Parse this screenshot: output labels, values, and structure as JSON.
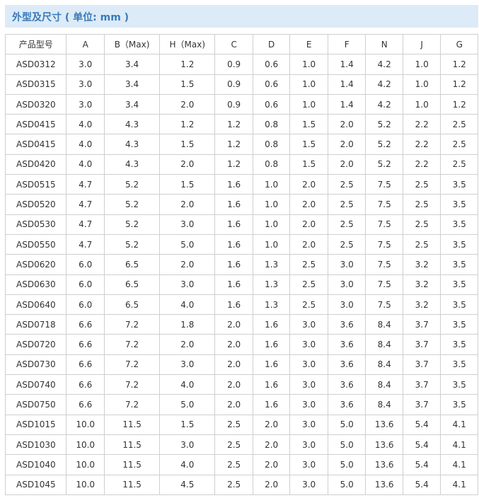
{
  "section": {
    "title": "外型及尺寸 ( 单位: mm )"
  },
  "table": {
    "headers": [
      "产品型号",
      "A",
      "B（Max)",
      "H（Max)",
      "C",
      "D",
      "E",
      "F",
      "N",
      "J",
      "G"
    ],
    "rows": [
      [
        "ASD0312",
        "3.0",
        "3.4",
        "1.2",
        "0.9",
        "0.6",
        "1.0",
        "1.4",
        "4.2",
        "1.0",
        "1.2"
      ],
      [
        "ASD0315",
        "3.0",
        "3.4",
        "1.5",
        "0.9",
        "0.6",
        "1.0",
        "1.4",
        "4.2",
        "1.0",
        "1.2"
      ],
      [
        "ASD0320",
        "3.0",
        "3.4",
        "2.0",
        "0.9",
        "0.6",
        "1.0",
        "1.4",
        "4.2",
        "1.0",
        "1.2"
      ],
      [
        "ASD0415",
        "4.0",
        "4.3",
        "1.2",
        "1.2",
        "0.8",
        "1.5",
        "2.0",
        "5.2",
        "2.2",
        "2.5"
      ],
      [
        "ASD0415",
        "4.0",
        "4.3",
        "1.5",
        "1.2",
        "0.8",
        "1.5",
        "2.0",
        "5.2",
        "2.2",
        "2.5"
      ],
      [
        "ASD0420",
        "4.0",
        "4.3",
        "2.0",
        "1.2",
        "0.8",
        "1.5",
        "2.0",
        "5.2",
        "2.2",
        "2.5"
      ],
      [
        "ASD0515",
        "4.7",
        "5.2",
        "1.5",
        "1.6",
        "1.0",
        "2.0",
        "2.5",
        "7.5",
        "2.5",
        "3.5"
      ],
      [
        "ASD0520",
        "4.7",
        "5.2",
        "2.0",
        "1.6",
        "1.0",
        "2.0",
        "2.5",
        "7.5",
        "2.5",
        "3.5"
      ],
      [
        "ASD0530",
        "4.7",
        "5.2",
        "3.0",
        "1.6",
        "1.0",
        "2.0",
        "2.5",
        "7.5",
        "2.5",
        "3.5"
      ],
      [
        "ASD0550",
        "4.7",
        "5.2",
        "5.0",
        "1.6",
        "1.0",
        "2.0",
        "2.5",
        "7.5",
        "2.5",
        "3.5"
      ],
      [
        "ASD0620",
        "6.0",
        "6.5",
        "2.0",
        "1.6",
        "1.3",
        "2.5",
        "3.0",
        "7.5",
        "3.2",
        "3.5"
      ],
      [
        "ASD0630",
        "6.0",
        "6.5",
        "3.0",
        "1.6",
        "1.3",
        "2.5",
        "3.0",
        "7.5",
        "3.2",
        "3.5"
      ],
      [
        "ASD0640",
        "6.0",
        "6.5",
        "4.0",
        "1.6",
        "1.3",
        "2.5",
        "3.0",
        "7.5",
        "3.2",
        "3.5"
      ],
      [
        "ASD0718",
        "6.6",
        "7.2",
        "1.8",
        "2.0",
        "1.6",
        "3.0",
        "3.6",
        "8.4",
        "3.7",
        "3.5"
      ],
      [
        "ASD0720",
        "6.6",
        "7.2",
        "2.0",
        "2.0",
        "1.6",
        "3.0",
        "3.6",
        "8.4",
        "3.7",
        "3.5"
      ],
      [
        "ASD0730",
        "6.6",
        "7.2",
        "3.0",
        "2.0",
        "1.6",
        "3.0",
        "3.6",
        "8.4",
        "3.7",
        "3.5"
      ],
      [
        "ASD0740",
        "6.6",
        "7.2",
        "4.0",
        "2.0",
        "1.6",
        "3.0",
        "3.6",
        "8.4",
        "3.7",
        "3.5"
      ],
      [
        "ASD0750",
        "6.6",
        "7.2",
        "5.0",
        "2.0",
        "1.6",
        "3.0",
        "3.6",
        "8.4",
        "3.7",
        "3.5"
      ],
      [
        "ASD1015",
        "10.0",
        "11.5",
        "1.5",
        "2.5",
        "2.0",
        "3.0",
        "5.0",
        "13.6",
        "5.4",
        "4.1"
      ],
      [
        "ASD1030",
        "10.0",
        "11.5",
        "3.0",
        "2.5",
        "2.0",
        "3.0",
        "5.0",
        "13.6",
        "5.4",
        "4.1"
      ],
      [
        "ASD1040",
        "10.0",
        "11.5",
        "4.0",
        "2.5",
        "2.0",
        "3.0",
        "5.0",
        "13.6",
        "5.4",
        "4.1"
      ],
      [
        "ASD1045",
        "10.0",
        "11.5",
        "4.5",
        "2.5",
        "2.0",
        "3.0",
        "5.0",
        "13.6",
        "5.4",
        "4.1"
      ]
    ]
  }
}
